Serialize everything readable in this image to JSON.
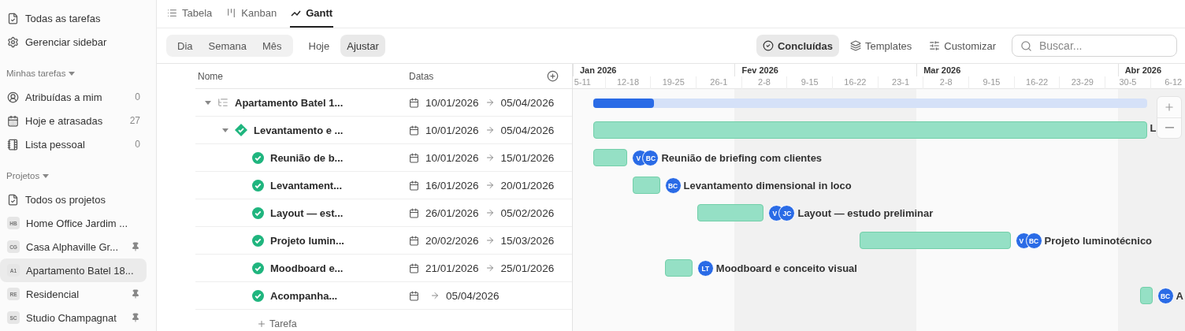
{
  "sidebar": {
    "nav": [
      {
        "label": "Todas as tarefas"
      },
      {
        "label": "Gerenciar sidebar"
      }
    ],
    "sections": [
      {
        "title": "Minhas tarefas",
        "expanded": true,
        "items": [
          {
            "kind": "link",
            "label": "Atribuídas a mim",
            "count": "0",
            "selected": false
          },
          {
            "kind": "link",
            "label": "Hoje e atrasadas",
            "count": "27",
            "selected": false
          },
          {
            "kind": "link",
            "label": "Lista pessoal",
            "count": "0",
            "selected": false
          }
        ]
      },
      {
        "title": "Projetos",
        "expanded": true,
        "items": [
          {
            "kind": "link",
            "label": "Todos os projetos",
            "selected": false
          },
          {
            "kind": "project",
            "badge": "HB",
            "label": "Home Office Jardim ...",
            "pinned": false,
            "selected": false
          },
          {
            "kind": "project",
            "badge": "CG",
            "label": "Casa Alphaville Gr...",
            "pinned": true,
            "selected": false
          },
          {
            "kind": "project",
            "badge": "A1",
            "label": "Apartamento Batel 18...",
            "pinned": false,
            "selected": true
          },
          {
            "kind": "project",
            "badge": "RE",
            "label": "Residencial",
            "pinned": true,
            "selected": false
          },
          {
            "kind": "project",
            "badge": "SC",
            "label": "Studio Champagnat",
            "pinned": true,
            "selected": false
          }
        ]
      }
    ]
  },
  "views": [
    {
      "label": "Tabela",
      "selected": false
    },
    {
      "label": "Kanban",
      "selected": false
    },
    {
      "label": "Gantt",
      "selected": true
    }
  ],
  "toolbar": {
    "scales": [
      {
        "label": "Dia",
        "selected": false
      },
      {
        "label": "Semana",
        "selected": false
      },
      {
        "label": "Mês",
        "selected": false
      }
    ],
    "today": "Hoje",
    "fit": "Ajustar",
    "filters": [
      {
        "label": "Concluídas",
        "active": true
      },
      {
        "label": "Templates",
        "active": false
      },
      {
        "label": "Customizar",
        "active": false
      }
    ],
    "search": {
      "placeholder": "Buscar..."
    }
  },
  "table": {
    "columns": [
      "Nome",
      "Datas"
    ],
    "add_task": "Tarefa",
    "rows": [
      {
        "kind": "project",
        "name": "Apartamento Batel 1...",
        "expanded": true,
        "start": "10/01/2026",
        "end": "05/04/2026",
        "level": 0.11,
        "children": [
          {
            "kind": "group",
            "name": "Levantamento e ...",
            "expanded": true,
            "start": "10/01/2026",
            "end": "05/04/2026",
            "bar_label": "L",
            "children": [
              {
                "kind": "task",
                "name": "Reunião de b...",
                "done": true,
                "start": "10/01/2026",
                "end": "15/01/2026",
                "assignees": [
                  "V",
                  "BC"
                ],
                "bar_label": "Reunião de briefing com clientes"
              },
              {
                "kind": "task",
                "name": "Levantament...",
                "done": true,
                "start": "16/01/2026",
                "end": "20/01/2026",
                "assignees": [
                  "BC"
                ],
                "bar_label": "Levantamento dimensional in loco"
              },
              {
                "kind": "task",
                "name": "Layout — est...",
                "done": true,
                "start": "26/01/2026",
                "end": "05/02/2026",
                "assignees": [
                  "V",
                  "JC"
                ],
                "bar_label": "Layout — estudo preliminar"
              },
              {
                "kind": "task",
                "name": "Projeto lumin...",
                "done": true,
                "start": "20/02/2026",
                "end": "15/03/2026",
                "assignees": [
                  "V",
                  "BC"
                ],
                "bar_label": "Projeto luminotécnico"
              },
              {
                "kind": "task",
                "name": "Moodboard e...",
                "done": true,
                "start": "21/01/2026",
                "end": "25/01/2026",
                "assignees": [
                  "LT"
                ],
                "bar_label": "Moodboard e conceito visual"
              },
              {
                "kind": "task",
                "name": "Acompanha...",
                "done": true,
                "end": "05/04/2026",
                "assignees": [
                  "BC"
                ],
                "bar_label": "A"
              }
            ]
          }
        ]
      }
    ]
  },
  "timeline": {
    "months": [
      "Jan 2026",
      "Fev 2026",
      "Mar 2026",
      "Abr 2026"
    ],
    "weeks": [
      "5-11",
      "12-18",
      "19-25",
      "26-1",
      "2-8",
      "9-15",
      "16-22",
      "23-1",
      "2-8",
      "9-15",
      "16-22",
      "23-29",
      "30-5",
      "6-12"
    ]
  }
}
